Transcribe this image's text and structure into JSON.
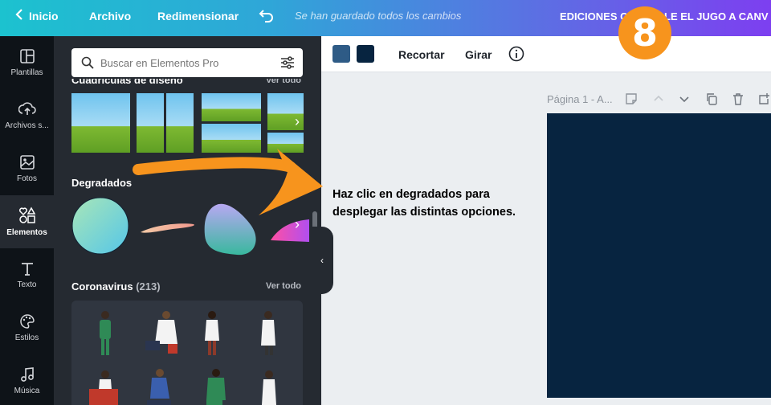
{
  "topbar": {
    "back_label": "Inicio",
    "file_label": "Archivo",
    "resize_label": "Redimensionar",
    "saved_status": "Se han guardado todos los cambios",
    "doc_title": "EDICIONES CE... ÍCALE EL JUGO A CANV",
    "step_number": "8",
    "colors": {
      "gradient_start": "#1cc2cf",
      "gradient_end": "#7d3ff0",
      "badge": "#f7941d"
    }
  },
  "rail": {
    "items": [
      {
        "label": "Plantillas",
        "icon": "layout-icon"
      },
      {
        "label": "Archivos s...",
        "icon": "upload-icon"
      },
      {
        "label": "Fotos",
        "icon": "photo-icon"
      },
      {
        "label": "Elementos",
        "icon": "shapes-icon",
        "active": true
      },
      {
        "label": "Texto",
        "icon": "text-icon"
      },
      {
        "label": "Estilos",
        "icon": "palette-icon"
      },
      {
        "label": "Música",
        "icon": "music-icon"
      }
    ]
  },
  "panel": {
    "search_placeholder": "Buscar en Elementos Pro",
    "sections": {
      "grids": {
        "title": "Cuadrículas de diseño",
        "see_all": "Ver todo"
      },
      "gradients": {
        "title": "Degradados"
      },
      "corona": {
        "title": "Coronavirus",
        "count": "(213)",
        "see_all": "Ver todo"
      }
    }
  },
  "editor": {
    "swatches": [
      "#2e5b86",
      "#072440"
    ],
    "crop_label": "Recortar",
    "rotate_label": "Girar",
    "page_label": "Página 1 - A...",
    "canvas_color": "#072440"
  },
  "annotation": {
    "line1": "Haz clic en degradados para",
    "line2": "desplegar las distintas opciones."
  }
}
